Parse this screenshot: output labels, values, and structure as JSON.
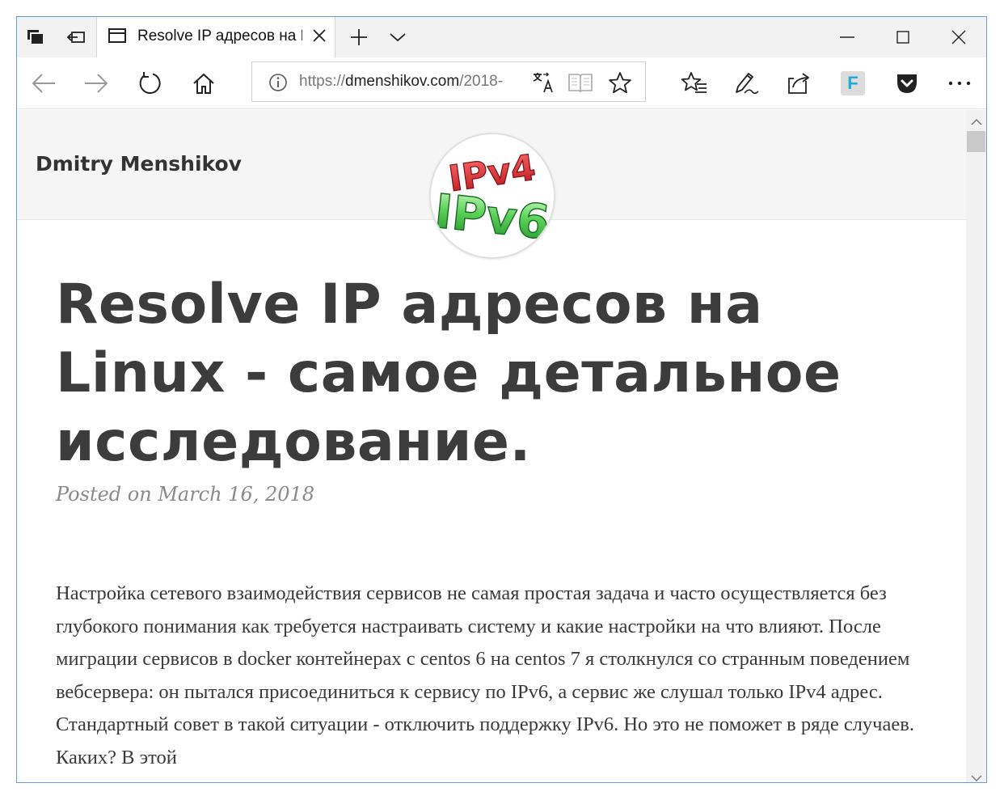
{
  "window": {
    "tab_title": "Resolve IP адресов на L",
    "colors": {
      "frame": "#6b9bd1",
      "tabstrip": "#f2f2f2",
      "page_header_bg": "#f5f5f5",
      "title_text": "#3c3c3c"
    }
  },
  "addressbar": {
    "scheme": "https://",
    "host": "dmenshikov.com",
    "path": "/2018-"
  },
  "toolbar": {
    "icons": [
      "tab-preview-icon",
      "set-aside-tabs-icon",
      "new-tab-icon",
      "tab-list-chevron-icon",
      "back-icon",
      "forward-icon",
      "refresh-icon",
      "home-icon",
      "site-info-icon",
      "translate-icon",
      "reading-view-icon",
      "favorite-star-icon",
      "favorites-hub-icon",
      "web-note-icon",
      "share-icon",
      "f-extension-icon",
      "pocket-icon",
      "more-icon"
    ],
    "extension_f_label": "F"
  },
  "page": {
    "site_name": "Dmitry Menshikov",
    "logo": {
      "top": "IPv4",
      "bottom": "IPv6",
      "colors": {
        "ipv4": "#d7263d",
        "ipv6": "#3cb44b"
      }
    },
    "title": "Resolve IP адресов на Linux - самое детальное исследование.",
    "posted": "Posted on March 16, 2018",
    "body": "Настройка сетевого взаимодействия сервисов не самая простая задача и часто осуществляется без глубокого понимания как требуется настраивать систему и какие настройки на что влияют. После миграции сервисов в docker контейнерах с centos 6 на centos 7 я столкнулся со странным поведением вебсервера: он пытался присоединиться к сервису по IPv6, а сервис же слушал только IPv4 адрес. Стандартный совет в такой ситуации - отключить поддержку IPv6. Но это не поможет в ряде случаев. Каких? В этой"
  }
}
